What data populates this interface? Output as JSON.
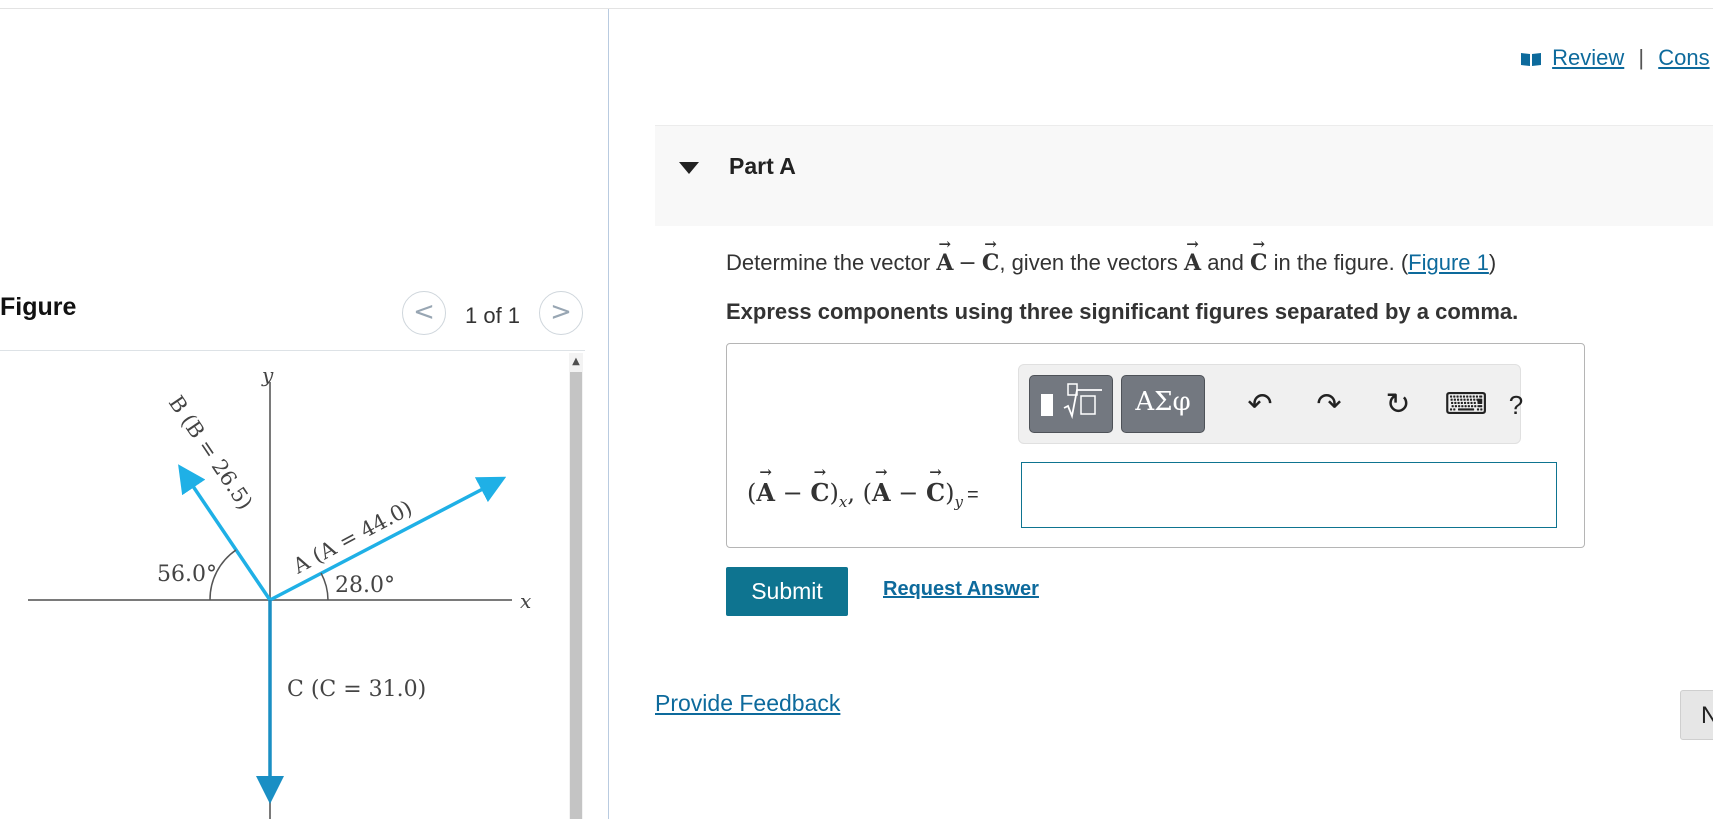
{
  "header": {
    "review_label": "Review",
    "separator": "|",
    "constants_label": "Cons"
  },
  "figure_panel": {
    "title": "Figure",
    "page_counter": "1 of 1",
    "prev_glyph": "<",
    "next_glyph": ">",
    "diagram": {
      "y_label": "y",
      "x_label": "x",
      "vector_a_label": "A (A = 44.0)",
      "vector_b_label": "B (B = 26.5)",
      "vector_c_label": "C (C = 31.0)",
      "angle_a_label": "28.0°",
      "angle_b_label": "56.0°",
      "vector_color": "#1fb0e6"
    }
  },
  "part": {
    "title": "Part A",
    "question": {
      "prefix": "Determine the vector ",
      "vec_a": "A",
      "minus": "−",
      "vec_c": "C",
      "middle": ", given the vectors ",
      "vec_a2": "A",
      "and": " and ",
      "vec_c2": "C",
      "suffix": " in the figure. (",
      "figure_link": "Figure 1",
      "close": ")"
    },
    "instruction": "Express components using three significant figures separated by a comma.",
    "toolbar": {
      "templates_icon": "templates-icon",
      "symbols_label": "ΑΣφ",
      "undo_icon": "↶",
      "redo_icon": "↷",
      "reset_icon": "↻",
      "keyboard_icon": "⌨",
      "help_label": "?"
    },
    "answer_label": {
      "open": "(",
      "vec_a": "A",
      "minus": " − ",
      "vec_c": "C",
      "close": ")",
      "sub_x": "x",
      "comma": ", ",
      "open2": "(",
      "vec_a2": "A",
      "minus2": " − ",
      "vec_c2": "C",
      "close2": ")",
      "sub_y": "y",
      "equals": "="
    },
    "answer_value": "",
    "submit_label": "Submit",
    "request_answer_label": "Request Answer"
  },
  "footer": {
    "feedback_label": "Provide Feedback",
    "next_label": "N"
  },
  "colors": {
    "accent": "#0e7490",
    "link": "#0d6a9c"
  }
}
